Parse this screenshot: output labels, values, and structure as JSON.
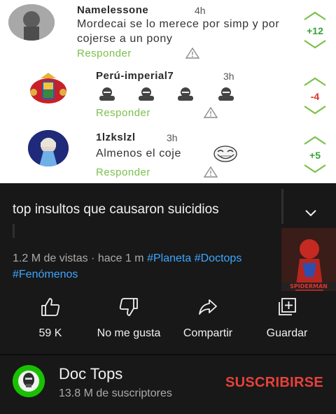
{
  "comments": [
    {
      "author": "Namelessone",
      "time": "4h",
      "text": "Mordecai se lo merece por simp y por cojerse a un pony",
      "reply_label": "Responder",
      "score": "+12",
      "score_color": "#3aa23a"
    },
    {
      "author": "Perú-imperial7",
      "time": "3h",
      "text": "",
      "reply_label": "Responder",
      "score": "-4",
      "score_color": "#e0302a"
    },
    {
      "author": "1lzkslzl",
      "time": "3h",
      "text": "Almenos el coje",
      "reply_label": "Responder",
      "score": "+5",
      "score_color": "#3aa23a"
    }
  ],
  "video": {
    "title": "top insultos que causaron suicidios",
    "views": "1.2 M de vistas · hace 1 m",
    "tags": [
      "#Planeta",
      "#Doctops",
      "#Fenómenos"
    ]
  },
  "actions": {
    "like_label": "59 K",
    "dislike_label": "No me gusta",
    "share_label": "Compartir",
    "save_label": "Guardar"
  },
  "channel": {
    "name": "Doc Tops",
    "subscribers": "13.8 M de suscriptores",
    "subscribe_label": "SUSCRIBIRSE"
  },
  "colors": {
    "accent_green": "#7cc04b",
    "vote_arrow": "#7cc04b",
    "link_blue": "#3ea6ff",
    "subscribe_red": "#e8413a",
    "background": "#181818"
  },
  "icons": [
    "like-icon",
    "dislike-icon",
    "share-icon",
    "save-icon",
    "chevron-down-icon",
    "warning-icon",
    "upvote-icon",
    "downvote-icon",
    "trollface-icon"
  ]
}
